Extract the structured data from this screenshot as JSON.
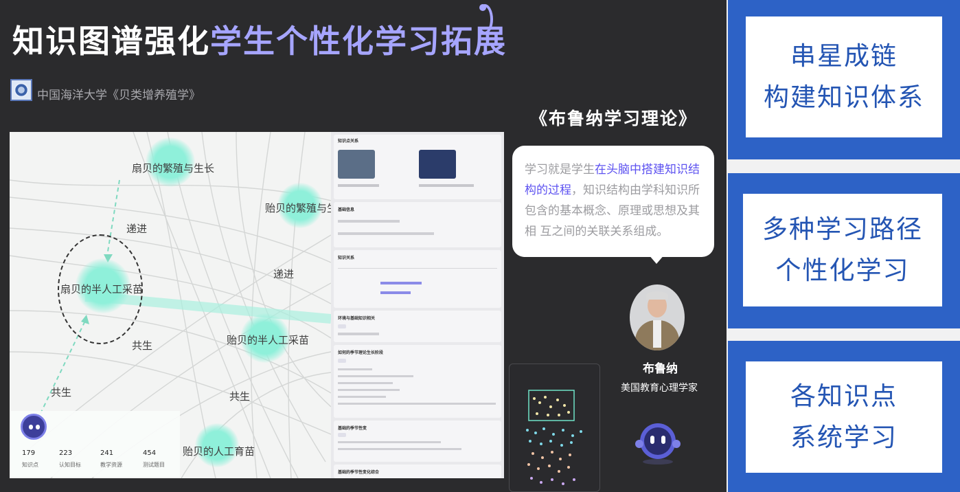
{
  "title": {
    "part_white": "知识图谱强化",
    "part_purple": "学生个性化学习拓展"
  },
  "school": {
    "name": "中国海洋大学《贝类增养殖学》"
  },
  "graph": {
    "nodes": [
      {
        "label": "扇贝的繁殖与生长"
      },
      {
        "label": "贻贝的繁殖与生"
      },
      {
        "label": "扇贝的半人工采苗"
      },
      {
        "label": "贻贝的半人工采苗"
      },
      {
        "label": "贻贝的人工育苗"
      }
    ],
    "edge_labels": [
      "递进",
      "递进",
      "共生",
      "共生",
      "共生"
    ],
    "stats": [
      {
        "value": "179",
        "label": "知识点"
      },
      {
        "value": "223",
        "label": "认知目标"
      },
      {
        "value": "241",
        "label": "教学资源"
      },
      {
        "value": "454",
        "label": "测试题目"
      }
    ]
  },
  "detail_panel": {
    "sections": [
      {
        "heading": "知识点关系"
      },
      {
        "heading": "基础信息"
      },
      {
        "heading": "知识关系"
      },
      {
        "heading": "环境与基础知识相关"
      },
      {
        "heading": "如何的季节理论生长阶段"
      },
      {
        "heading": "基础的季节性变"
      },
      {
        "heading": "基础的季节性变化综合"
      }
    ]
  },
  "bruner": {
    "theory_title": "《布鲁纳学习理论》",
    "quote_start": "学习就是学生",
    "quote_highlight": "在头脑中搭建知识结构的过程",
    "quote_rest": "，知识结构由学科知识所包含的基本概念、原理或思想及其相 互之间的关联关系组成。",
    "name": "布鲁纳",
    "role": "美国教育心理学家"
  },
  "cards": [
    {
      "line1": "串星成链",
      "line2": "构建知识体系"
    },
    {
      "line1": "多种学习路径",
      "line2": "个性化学习"
    },
    {
      "line1": "各知识点",
      "line2": "系统学习"
    }
  ],
  "colors": {
    "background": "#2b2b2d",
    "title_purple": "#a6a5ff",
    "card_blue": "#2d62c6",
    "card_text": "#2455b3",
    "highlight": "#5d52f0",
    "node_green": "#8ff0da"
  }
}
